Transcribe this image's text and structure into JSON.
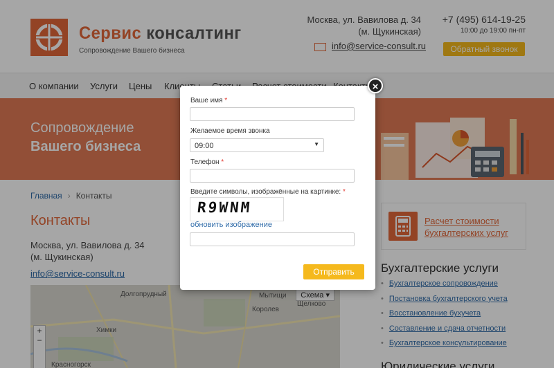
{
  "header": {
    "brand_part1": "Сервис",
    "brand_part2": "консалтинг",
    "tagline": "Сопровождение Вашего бизнеса",
    "address_line1": "Москва, ул. Вавилова д. 34",
    "address_line2": "(м. Щукинская)",
    "email": "info@service-consult.ru",
    "phone": "+7 (495) 614-19-25",
    "hours": "10:00 до 19:00 пн-пт",
    "callback_button": "Обратный звонок"
  },
  "nav": {
    "items": [
      "О компании",
      "Услуги",
      "Цены",
      "Клиенты",
      "Статьи",
      "Расчет стоимости",
      "Контакты"
    ]
  },
  "banner": {
    "line1": "Сопровождение",
    "line2": "Вашего бизнеса"
  },
  "breadcrumb": {
    "home": "Главная",
    "separator": "›",
    "current": "Контакты"
  },
  "content": {
    "title": "Контакты",
    "address_line1": "Москва, ул. Вавилова д. 34",
    "address_line2": "(м. Щукинская)",
    "email": "info@service-consult.ru"
  },
  "map": {
    "scheme_label": "Схема",
    "labels": [
      "Долгопрудный",
      "Мытищи",
      "Химки",
      "Щелково",
      "Королев",
      "Красногорск"
    ],
    "zoom_in": "+",
    "zoom_out": "−"
  },
  "sidebar": {
    "calc_line1": "Расчет стоимости",
    "calc_line2": "бухгалтерских услуг",
    "section_title": "Бухгалтерские услуги",
    "links": [
      "Бухгалтерское сопровождение",
      "Постановка бухгалтерского учета",
      "Восстановление бухучета",
      "Составление и сдача отчетности",
      "Бухгалтерское консультирование"
    ],
    "section2_title": "Юридические услуги"
  },
  "modal": {
    "close_glyph": "×",
    "name_label": "Ваше имя",
    "name_value": "",
    "time_label": "Желаемое время звонка",
    "time_value": "09:00",
    "phone_label": "Телефон",
    "phone_value": "",
    "captcha_label": "Введите символы, изображённые на картинке:",
    "captcha_text": "R9WNM",
    "refresh_link": "обновить изображение",
    "captcha_value": "",
    "required_mark": "*",
    "submit_label": "Отправить"
  },
  "colors": {
    "accent": "#e2673a",
    "button": "#f5b91d",
    "link": "#2f6ba8"
  }
}
